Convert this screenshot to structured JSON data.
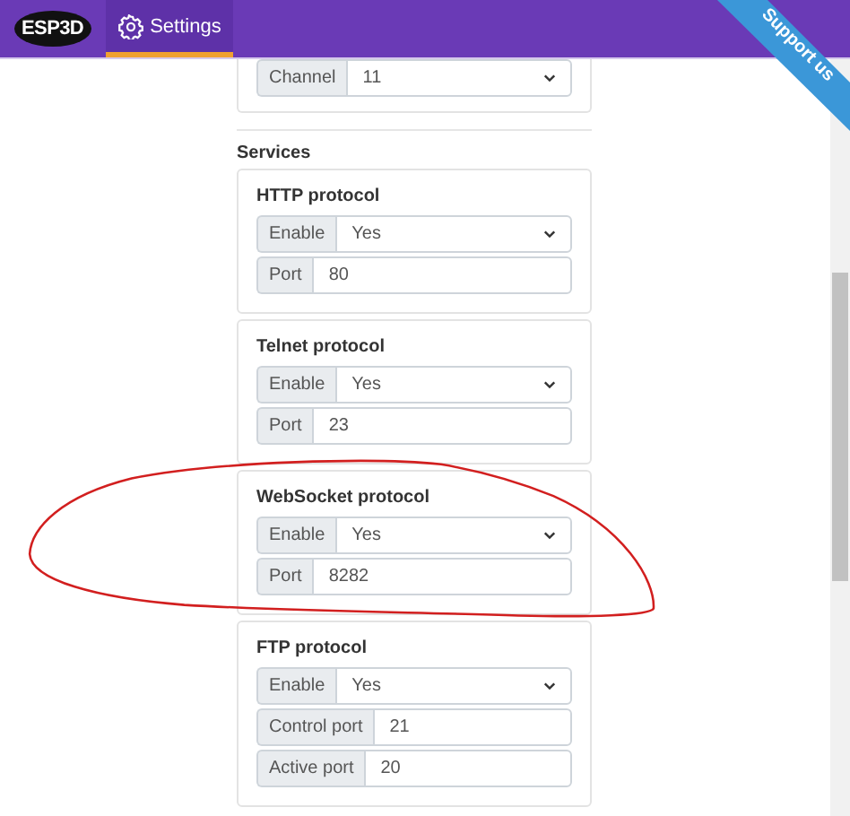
{
  "nav": {
    "logo": "ESP3D",
    "tabs": [
      {
        "label": "Settings",
        "selected": true
      }
    ]
  },
  "ribbon": {
    "label": "Support us"
  },
  "top_card": {
    "fields": [
      {
        "kind": "select",
        "label": "Channel",
        "value": "11"
      }
    ]
  },
  "section": {
    "title": "Services",
    "cards": [
      {
        "title": "HTTP protocol",
        "circled": false,
        "fields": [
          {
            "kind": "select",
            "label": "Enable",
            "value": "Yes"
          },
          {
            "kind": "text",
            "label": "Port",
            "value": "80"
          }
        ]
      },
      {
        "title": "Telnet protocol",
        "circled": false,
        "fields": [
          {
            "kind": "select",
            "label": "Enable",
            "value": "Yes"
          },
          {
            "kind": "text",
            "label": "Port",
            "value": "23"
          }
        ]
      },
      {
        "title": "WebSocket protocol",
        "circled": true,
        "fields": [
          {
            "kind": "select",
            "label": "Enable",
            "value": "Yes"
          },
          {
            "kind": "text",
            "label": "Port",
            "value": "8282"
          }
        ]
      },
      {
        "title": "FTP protocol",
        "circled": false,
        "fields": [
          {
            "kind": "select",
            "label": "Enable",
            "value": "Yes"
          },
          {
            "kind": "text",
            "label": "Control port",
            "value": "21"
          },
          {
            "kind": "text",
            "label": "Active port",
            "value": "20"
          }
        ]
      }
    ]
  }
}
